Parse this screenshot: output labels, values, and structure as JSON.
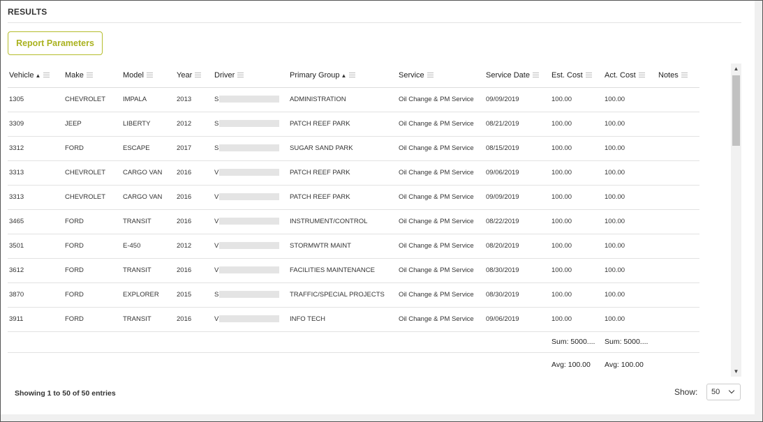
{
  "header": {
    "title": "RESULTS"
  },
  "report_button": {
    "label": "Report Parameters"
  },
  "columns": [
    {
      "label": "Vehicle",
      "sort": "▲"
    },
    {
      "label": "Make",
      "sort": ""
    },
    {
      "label": "Model",
      "sort": ""
    },
    {
      "label": "Year",
      "sort": ""
    },
    {
      "label": "Driver",
      "sort": ""
    },
    {
      "label": "Primary Group",
      "sort": "▲"
    },
    {
      "label": "Service",
      "sort": ""
    },
    {
      "label": "Service Date",
      "sort": ""
    },
    {
      "label": "Est. Cost",
      "sort": ""
    },
    {
      "label": "Act. Cost",
      "sort": ""
    },
    {
      "label": "Notes",
      "sort": ""
    }
  ],
  "rows": [
    {
      "vehicle": "1305",
      "make": "CHEVROLET",
      "model": "IMPALA",
      "year": "2013",
      "driver": "S",
      "group": "ADMINISTRATION",
      "service": "Oil Change & PM Service",
      "date": "09/09/2019",
      "est": "100.00",
      "act": "100.00",
      "notes": ""
    },
    {
      "vehicle": "3309",
      "make": "JEEP",
      "model": "LIBERTY",
      "year": "2012",
      "driver": "S",
      "group": "PATCH REEF PARK",
      "service": "Oil Change & PM Service",
      "date": "08/21/2019",
      "est": "100.00",
      "act": "100.00",
      "notes": ""
    },
    {
      "vehicle": "3312",
      "make": "FORD",
      "model": "ESCAPE",
      "year": "2017",
      "driver": "S",
      "group": "SUGAR SAND PARK",
      "service": "Oil Change & PM Service",
      "date": "08/15/2019",
      "est": "100.00",
      "act": "100.00",
      "notes": ""
    },
    {
      "vehicle": "3313",
      "make": "CHEVROLET",
      "model": "CARGO VAN",
      "year": "2016",
      "driver": "V",
      "group": "PATCH REEF PARK",
      "service": "Oil Change & PM Service",
      "date": "09/06/2019",
      "est": "100.00",
      "act": "100.00",
      "notes": ""
    },
    {
      "vehicle": "3313",
      "make": "CHEVROLET",
      "model": "CARGO VAN",
      "year": "2016",
      "driver": "V",
      "group": "PATCH REEF PARK",
      "service": "Oil Change & PM Service",
      "date": "09/09/2019",
      "est": "100.00",
      "act": "100.00",
      "notes": ""
    },
    {
      "vehicle": "3465",
      "make": "FORD",
      "model": "TRANSIT",
      "year": "2016",
      "driver": "V",
      "group": "INSTRUMENT/CONTROL",
      "service": "Oil Change & PM Service",
      "date": "08/22/2019",
      "est": "100.00",
      "act": "100.00",
      "notes": ""
    },
    {
      "vehicle": "3501",
      "make": "FORD",
      "model": "E-450",
      "year": "2012",
      "driver": "V",
      "group": "STORMWTR MAINT",
      "service": "Oil Change & PM Service",
      "date": "08/20/2019",
      "est": "100.00",
      "act": "100.00",
      "notes": ""
    },
    {
      "vehicle": "3612",
      "make": "FORD",
      "model": "TRANSIT",
      "year": "2016",
      "driver": "V",
      "group": "FACILITIES MAINTENANCE",
      "service": "Oil Change & PM Service",
      "date": "08/30/2019",
      "est": "100.00",
      "act": "100.00",
      "notes": ""
    },
    {
      "vehicle": "3870",
      "make": "FORD",
      "model": "EXPLORER",
      "year": "2015",
      "driver": "S",
      "group": "TRAFFIC/SPECIAL PROJECTS",
      "service": "Oil Change & PM Service",
      "date": "08/30/2019",
      "est": "100.00",
      "act": "100.00",
      "notes": ""
    },
    {
      "vehicle": "3911",
      "make": "FORD",
      "model": "TRANSIT",
      "year": "2016",
      "driver": "V",
      "group": "INFO TECH",
      "service": "Oil Change & PM Service",
      "date": "09/06/2019",
      "est": "100.00",
      "act": "100.00",
      "notes": ""
    }
  ],
  "summary": {
    "sum_est": "Sum: 5000....",
    "sum_act": "Sum: 5000....",
    "avg_est": "Avg: 100.00",
    "avg_act": "Avg: 100.00"
  },
  "scrollbar": {
    "up_glyph": "▲",
    "down_glyph": "▼"
  },
  "footer": {
    "status": "Showing 1 to 50 of 50 entries",
    "show_label": "Show:",
    "page_size": "50"
  }
}
